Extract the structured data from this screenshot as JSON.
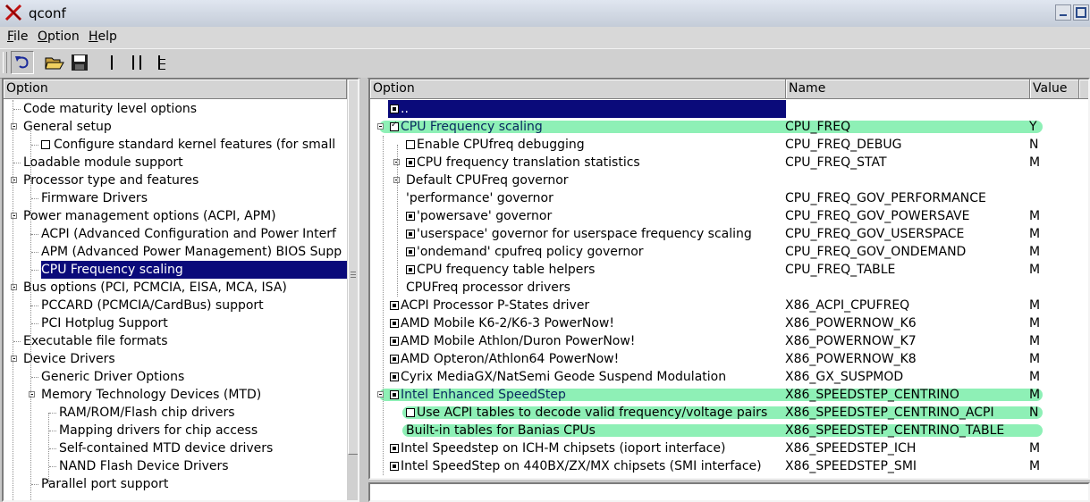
{
  "window": {
    "title": "qconf"
  },
  "menu": [
    {
      "acc": "F",
      "rest": "ile"
    },
    {
      "acc": "O",
      "rest": "ption"
    },
    {
      "acc": "H",
      "rest": "elp"
    }
  ],
  "toolbar": {
    "buttons": [
      "back-icon",
      "open-icon",
      "save-icon",
      "single-view-icon",
      "split-view-icon",
      "full-view-icon"
    ]
  },
  "left": {
    "header": "Option",
    "items": [
      {
        "label": "Code maturity level options",
        "depth": 0,
        "expand": false,
        "box": ""
      },
      {
        "label": "General setup",
        "depth": 0,
        "expand": true,
        "box": ""
      },
      {
        "label": "Configure standard kernel features (for small",
        "depth": 1,
        "expand": false,
        "box": "empty"
      },
      {
        "label": "Loadable module support",
        "depth": 0,
        "expand": false,
        "box": ""
      },
      {
        "label": "Processor type and features",
        "depth": 0,
        "expand": true,
        "box": ""
      },
      {
        "label": "Firmware Drivers",
        "depth": 1,
        "expand": false,
        "box": ""
      },
      {
        "label": "Power management options (ACPI, APM)",
        "depth": 0,
        "expand": true,
        "box": ""
      },
      {
        "label": "ACPI (Advanced Configuration and Power Interf",
        "depth": 1,
        "expand": false,
        "box": ""
      },
      {
        "label": "APM (Advanced Power Management) BIOS Supp",
        "depth": 1,
        "expand": false,
        "box": ""
      },
      {
        "label": "CPU Frequency scaling",
        "depth": 1,
        "expand": false,
        "box": "",
        "selected": true
      },
      {
        "label": "Bus options (PCI, PCMCIA, EISA, MCA, ISA)",
        "depth": 0,
        "expand": true,
        "box": ""
      },
      {
        "label": "PCCARD (PCMCIA/CardBus) support",
        "depth": 1,
        "expand": false,
        "box": ""
      },
      {
        "label": "PCI Hotplug Support",
        "depth": 1,
        "expand": false,
        "box": ""
      },
      {
        "label": "Executable file formats",
        "depth": 0,
        "expand": false,
        "box": ""
      },
      {
        "label": "Device Drivers",
        "depth": 0,
        "expand": true,
        "box": ""
      },
      {
        "label": "Generic Driver Options",
        "depth": 1,
        "expand": false,
        "box": ""
      },
      {
        "label": "Memory Technology Devices (MTD)",
        "depth": 1,
        "expand": true,
        "box": ""
      },
      {
        "label": "RAM/ROM/Flash chip drivers",
        "depth": 2,
        "expand": false,
        "box": ""
      },
      {
        "label": "Mapping drivers for chip access",
        "depth": 2,
        "expand": false,
        "box": ""
      },
      {
        "label": "Self-contained MTD device drivers",
        "depth": 2,
        "expand": false,
        "box": ""
      },
      {
        "label": "NAND Flash Device Drivers",
        "depth": 2,
        "expand": false,
        "box": ""
      },
      {
        "label": "Parallel port support",
        "depth": 1,
        "expand": false,
        "box": ""
      }
    ]
  },
  "right": {
    "headers": {
      "option": "Option",
      "name": "Name",
      "value": "Value"
    },
    "items": [
      {
        "label": "..",
        "name": "",
        "value": "",
        "depth": 0,
        "box": "fill",
        "selected": true
      },
      {
        "label": "CPU Frequency scaling",
        "name": "CPU_FREQ",
        "value": "Y",
        "depth": 0,
        "expand": true,
        "box": "check",
        "hl": true
      },
      {
        "label": "Enable CPUfreq debugging",
        "name": "CPU_FREQ_DEBUG",
        "value": "N",
        "depth": 1,
        "box": "empty"
      },
      {
        "label": "CPU frequency translation statistics",
        "name": "CPU_FREQ_STAT",
        "value": "M",
        "depth": 1,
        "expand": true,
        "box": "fill"
      },
      {
        "label": "Default CPUFreq governor",
        "name": "",
        "value": "",
        "depth": 1,
        "expand": true,
        "box": ""
      },
      {
        "label": "'performance' governor",
        "name": "CPU_FREQ_GOV_PERFORMANCE",
        "value": "",
        "depth": 1,
        "box": ""
      },
      {
        "label": "'powersave' governor",
        "name": "CPU_FREQ_GOV_POWERSAVE",
        "value": "M",
        "depth": 1,
        "box": "fill"
      },
      {
        "label": "'userspace' governor for userspace frequency scaling",
        "name": "CPU_FREQ_GOV_USERSPACE",
        "value": "M",
        "depth": 1,
        "box": "fill"
      },
      {
        "label": "'ondemand' cpufreq policy governor",
        "name": "CPU_FREQ_GOV_ONDEMAND",
        "value": "M",
        "depth": 1,
        "box": "fill"
      },
      {
        "label": "CPU frequency table helpers",
        "name": "CPU_FREQ_TABLE",
        "value": "M",
        "depth": 1,
        "box": "fill"
      },
      {
        "label": "CPUFreq processor drivers",
        "name": "",
        "value": "",
        "depth": 1,
        "box": ""
      },
      {
        "label": "ACPI Processor P-States driver",
        "name": "X86_ACPI_CPUFREQ",
        "value": "M",
        "depth": 0,
        "box": "fill"
      },
      {
        "label": "AMD Mobile K6-2/K6-3 PowerNow!",
        "name": "X86_POWERNOW_K6",
        "value": "M",
        "depth": 0,
        "box": "fill"
      },
      {
        "label": "AMD Mobile Athlon/Duron PowerNow!",
        "name": "X86_POWERNOW_K7",
        "value": "M",
        "depth": 0,
        "box": "fill"
      },
      {
        "label": "AMD Opteron/Athlon64 PowerNow!",
        "name": "X86_POWERNOW_K8",
        "value": "M",
        "depth": 0,
        "box": "fill"
      },
      {
        "label": "Cyrix MediaGX/NatSemi Geode Suspend Modulation",
        "name": "X86_GX_SUSPMOD",
        "value": "M",
        "depth": 0,
        "box": "fill"
      },
      {
        "label": "Intel Enhanced SpeedStep",
        "name": "X86_SPEEDSTEP_CENTRINO",
        "value": "M",
        "depth": 0,
        "expand": true,
        "box": "fill",
        "hl": true
      },
      {
        "label": "Use ACPI tables to decode valid frequency/voltage pairs",
        "name": "X86_SPEEDSTEP_CENTRINO_ACPI",
        "value": "N",
        "depth": 1,
        "box": "empty",
        "hl": true
      },
      {
        "label": "Built-in tables for Banias CPUs",
        "name": "X86_SPEEDSTEP_CENTRINO_TABLE",
        "value": "",
        "depth": 1,
        "box": "",
        "hl": true
      },
      {
        "label": "Intel Speedstep on ICH-M chipsets (ioport interface)",
        "name": "X86_SPEEDSTEP_ICH",
        "value": "M",
        "depth": 0,
        "box": "fill"
      },
      {
        "label": "Intel SpeedStep on 440BX/ZX/MX chipsets (SMI interface)",
        "name": "X86_SPEEDSTEP_SMI",
        "value": "M",
        "depth": 0,
        "box": "fill"
      }
    ]
  }
}
